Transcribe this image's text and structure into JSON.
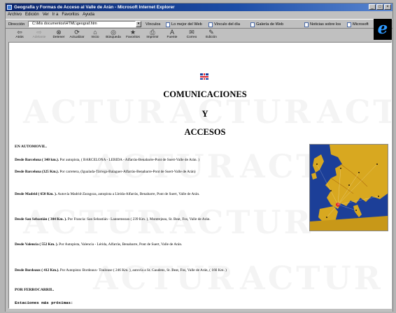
{
  "window": {
    "title": "Geografía y Formas de Acceso al Valle de Arán - Microsoft Internet Explorer"
  },
  "menu": [
    "Archivo",
    "Edición",
    "Ver",
    "Ir a",
    "Favoritos",
    "Ayuda"
  ],
  "address": {
    "label": "Dirección",
    "value": "C:\\Mis documentos\\HTML\\geograf.htm",
    "links_label": "Vínculos",
    "links": [
      "Lo mejor del Web",
      "Vínculo del día",
      "Galería de Web",
      "Noticias sobre los",
      "Microsoft"
    ]
  },
  "toolbar": {
    "buttons": [
      {
        "label": "Atrás",
        "icon": "back-arrow-icon",
        "glyph": "⇦",
        "enabled": true
      },
      {
        "label": "Adelante",
        "icon": "forward-arrow-icon",
        "glyph": "⇨",
        "enabled": false
      },
      {
        "label": "Detener",
        "icon": "stop-icon",
        "glyph": "⊗",
        "enabled": true
      },
      {
        "label": "Actualizar",
        "icon": "refresh-icon",
        "glyph": "⟳",
        "enabled": true
      },
      {
        "label": "Inicio",
        "icon": "home-icon",
        "glyph": "⌂",
        "enabled": true
      },
      {
        "label": "Búsqueda",
        "icon": "search-icon",
        "glyph": "◎",
        "enabled": true
      },
      {
        "label": "Favoritos",
        "icon": "favorites-icon",
        "glyph": "★",
        "enabled": true
      },
      {
        "label": "Imprimir",
        "icon": "print-icon",
        "glyph": "⎙",
        "enabled": true
      },
      {
        "label": "Fuente",
        "icon": "font-icon",
        "glyph": "A",
        "enabled": true
      },
      {
        "label": "Correo",
        "icon": "mail-icon",
        "glyph": "✉",
        "enabled": true
      },
      {
        "label": "Edición",
        "icon": "edit-icon",
        "glyph": "✎",
        "enabled": true
      }
    ]
  },
  "page": {
    "watermark": "ACTUR",
    "heading": [
      "COMUNICACIONES",
      "Y",
      "ACCESOS"
    ],
    "by_car_title": "EN AUTOMOVIL.",
    "routes": [
      {
        "origin": "Desde Barcelona ( 340 km.).",
        "detail": " Por autopista, ( BARCELONA - LERIDA - Alfarràs-Benabarre-Pont de Suert-Valle de Arán. )"
      },
      {
        "origin": "Desde Barcelona (325 Km.).",
        "detail": " Por carretera, (Igualada-Tàrrega-Balaguer-Alfarràs-Benabarre-Pont de Suert-Valle de Arán)"
      },
      {
        "origin": "Desde Madrid ( 650 Km. ).",
        "detail": " Autovía Madrid-Zaragoza, autopista a Lleida-Alfarràs, Benabarre, Pont de Suert, Valle de Arán."
      },
      {
        "origin": "Desde San Sebastián ( 304 Km. ).",
        "detail": " Por Francia: San Sebastián - Lannemezan ( 239 Km. ), Montrejeau, St. Beat, Fos, Valle de Arán."
      },
      {
        "origin": "Desde Valencia ( 552 Km. ).",
        "detail": " Por Autopista, Valencia - Lérida, Alfarràs, Benabarre, Pont de Suert, Valle de Arán."
      },
      {
        "origin": "Desde Bordeaux ( 412 Km.).",
        "detail": " Por Autopista: Bordeaux- Toulouse ( 246 Km. ), autovía a St. Gaudens, St. Beat, Fos, Valle de Arán, ( 166 Km. )"
      }
    ],
    "by_rail_title": "POR FERROCARRIL.",
    "stations_title": "Estaciones más próximas:"
  },
  "colors": {
    "titlebar": "#0a246a",
    "map_sea": "#1c3f98",
    "map_land": "#d8a820",
    "map_highlight": "#e02020"
  }
}
